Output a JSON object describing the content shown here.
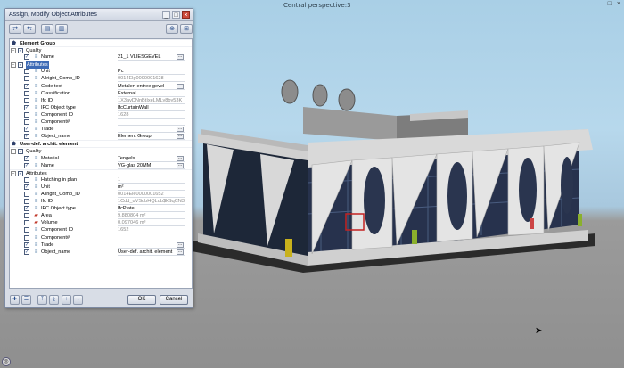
{
  "viewport": {
    "title": "Central perspective:3",
    "controls": [
      "–",
      "□",
      "×"
    ]
  },
  "dialog": {
    "title": "Assign, Modify Object Attributes",
    "window_buttons": [
      "_",
      "□",
      "×"
    ],
    "ok_label": "OK",
    "cancel_label": "Cancel"
  },
  "tree": [
    {
      "lbl": "Element Group",
      "val": "",
      "indent": 0,
      "exp": "",
      "chk": false,
      "icon": "group",
      "hdr": true
    },
    {
      "lbl": "Quality",
      "val": "",
      "indent": 0,
      "exp": "-",
      "chk": true,
      "icon": "",
      "hdr": false
    },
    {
      "lbl": "Name",
      "val": "21_1 VLIESGEVEL",
      "indent": 2,
      "exp": "",
      "chk": true,
      "icon": "attr",
      "dots": true
    },
    {
      "lbl": "Attributes",
      "val": "",
      "indent": 0,
      "exp": "-",
      "chk": true,
      "icon": "",
      "sel": true
    },
    {
      "lbl": "Unit",
      "val": "Pc",
      "indent": 2,
      "exp": "",
      "chk": false,
      "icon": "attr"
    },
    {
      "lbl": "Allright_Comp_ID",
      "val": "0014Elg0000001628",
      "indent": 2,
      "exp": "",
      "chk": false,
      "icon": "attr",
      "grey": true
    },
    {
      "lbl": "Code text",
      "val": "Metalen entree gevel",
      "indent": 2,
      "exp": "",
      "chk": true,
      "icon": "attr",
      "dots": true
    },
    {
      "lbl": "Classification",
      "val": "External",
      "indent": 2,
      "exp": "",
      "chk": false,
      "icon": "attr"
    },
    {
      "lbl": "Ifc ID",
      "val": "1X3avDNnBtIxeLMLy8by53K",
      "indent": 2,
      "exp": "",
      "chk": false,
      "icon": "attr",
      "grey": true
    },
    {
      "lbl": "IFC Object type",
      "val": "IfcCurtainWall",
      "indent": 2,
      "exp": "",
      "chk": true,
      "icon": "attr"
    },
    {
      "lbl": "Component ID",
      "val": "1628",
      "indent": 2,
      "exp": "",
      "chk": false,
      "icon": "attr",
      "grey": true
    },
    {
      "lbl": "Component#",
      "val": "",
      "indent": 2,
      "exp": "",
      "chk": false,
      "icon": "attr"
    },
    {
      "lbl": "Trade",
      "val": "",
      "indent": 2,
      "exp": "",
      "chk": true,
      "icon": "attr",
      "dots": true
    },
    {
      "lbl": "Object_name",
      "val": "Element Group",
      "indent": 2,
      "exp": "",
      "chk": true,
      "icon": "attr",
      "dots": true
    },
    {
      "lbl": "User-def. archit. element",
      "val": "",
      "indent": 0,
      "exp": "",
      "chk": false,
      "icon": "group",
      "hdr": true
    },
    {
      "lbl": "Quality",
      "val": "",
      "indent": 0,
      "exp": "-",
      "chk": true,
      "icon": ""
    },
    {
      "lbl": "Material",
      "val": "Tengels",
      "indent": 2,
      "exp": "",
      "chk": true,
      "icon": "attr",
      "dots": true
    },
    {
      "lbl": "Name",
      "val": "VG-glas 20MM",
      "indent": 2,
      "exp": "",
      "chk": true,
      "icon": "attr",
      "dots": true
    },
    {
      "lbl": "Attributes",
      "val": "",
      "indent": 0,
      "exp": "-",
      "chk": true,
      "icon": ""
    },
    {
      "lbl": "Hatching in plan",
      "val": "1",
      "indent": 2,
      "exp": "",
      "chk": false,
      "icon": "attr",
      "grey": true
    },
    {
      "lbl": "Unit",
      "val": "m²",
      "indent": 2,
      "exp": "",
      "chk": true,
      "icon": "attr"
    },
    {
      "lbl": "Allright_Comp_ID",
      "val": "0014Ele0000001652",
      "indent": 2,
      "exp": "",
      "chk": false,
      "icon": "attr",
      "grey": true
    },
    {
      "lbl": "Ifc ID",
      "val": "1Cdd_uVSqbHQLqb$kSqCN3",
      "indent": 2,
      "exp": "",
      "chk": false,
      "icon": "attr",
      "grey": true
    },
    {
      "lbl": "IFC Object type",
      "val": "IfcPlate",
      "indent": 2,
      "exp": "",
      "chk": true,
      "icon": "attr"
    },
    {
      "lbl": "Area",
      "val": "9.880804 m²",
      "indent": 2,
      "exp": "",
      "chk": false,
      "icon": "area",
      "grey": true
    },
    {
      "lbl": "Volume",
      "val": "0.097046 m³",
      "indent": 2,
      "exp": "",
      "chk": false,
      "icon": "area",
      "grey": true
    },
    {
      "lbl": "Component ID",
      "val": "1652",
      "indent": 2,
      "exp": "",
      "chk": false,
      "icon": "attr",
      "grey": true
    },
    {
      "lbl": "Component#",
      "val": "",
      "indent": 2,
      "exp": "",
      "chk": false,
      "icon": "attr"
    },
    {
      "lbl": "Trade",
      "val": "",
      "indent": 2,
      "exp": "",
      "chk": true,
      "icon": "attr",
      "dots": true
    },
    {
      "lbl": "Object_name",
      "val": "User-def. archit. element",
      "indent": 2,
      "exp": "",
      "chk": true,
      "icon": "attr",
      "dots": true
    }
  ]
}
